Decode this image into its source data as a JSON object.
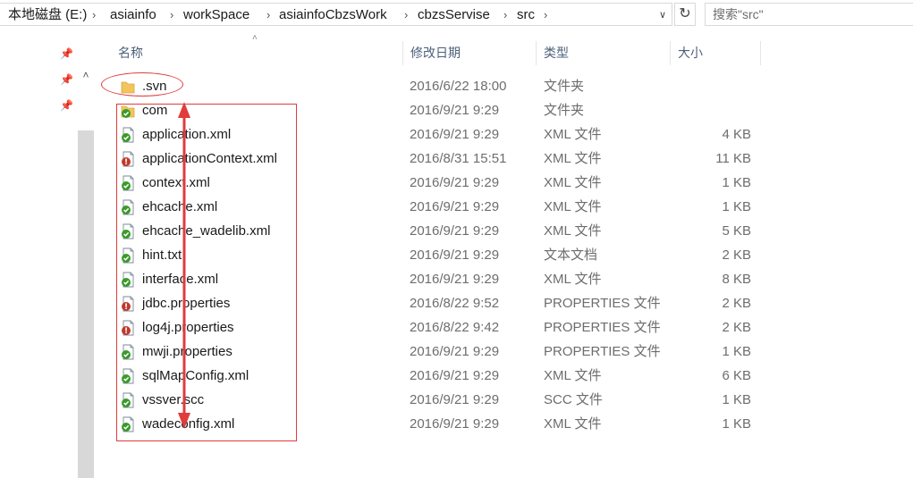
{
  "address_bar": {
    "crumbs": [
      "本地磁盘 (E:)",
      "asiainfo",
      "workSpace",
      "asiainfoCbzsWork",
      "cbzsServise",
      "src"
    ],
    "dropdown_icon": "chevron-down-icon",
    "refresh_icon": "refresh-icon"
  },
  "search": {
    "placeholder": "搜索\"src\""
  },
  "columns": {
    "name": "名称",
    "date": "修改日期",
    "type": "类型",
    "size": "大小"
  },
  "files": [
    {
      "name": ".svn",
      "date": "2016/6/22 18:00",
      "type": "文件夹",
      "size": "",
      "icon": "folder-icon"
    },
    {
      "name": "com",
      "date": "2016/9/21 9:29",
      "type": "文件夹",
      "size": "",
      "icon": "svn-folder-icon"
    },
    {
      "name": "application.xml",
      "date": "2016/9/21 9:29",
      "type": "XML 文件",
      "size": "4 KB",
      "icon": "svn-ok-file-icon"
    },
    {
      "name": "applicationContext.xml",
      "date": "2016/8/31 15:51",
      "type": "XML 文件",
      "size": "11 KB",
      "icon": "svn-modified-file-icon"
    },
    {
      "name": "context.xml",
      "date": "2016/9/21 9:29",
      "type": "XML 文件",
      "size": "1 KB",
      "icon": "svn-ok-file-icon"
    },
    {
      "name": "ehcache.xml",
      "date": "2016/9/21 9:29",
      "type": "XML 文件",
      "size": "1 KB",
      "icon": "svn-ok-file-icon"
    },
    {
      "name": "ehcache_wadelib.xml",
      "date": "2016/9/21 9:29",
      "type": "XML 文件",
      "size": "5 KB",
      "icon": "svn-ok-file-icon"
    },
    {
      "name": "hint.txt",
      "date": "2016/9/21 9:29",
      "type": "文本文档",
      "size": "2 KB",
      "icon": "svn-ok-file-icon"
    },
    {
      "name": "interface.xml",
      "date": "2016/9/21 9:29",
      "type": "XML 文件",
      "size": "8 KB",
      "icon": "svn-ok-file-icon"
    },
    {
      "name": "jdbc.properties",
      "date": "2016/8/22 9:52",
      "type": "PROPERTIES 文件",
      "size": "2 KB",
      "icon": "svn-modified-file-icon"
    },
    {
      "name": "log4j.properties",
      "date": "2016/8/22 9:42",
      "type": "PROPERTIES 文件",
      "size": "2 KB",
      "icon": "svn-modified-file-icon"
    },
    {
      "name": "mwji.properties",
      "date": "2016/9/21 9:29",
      "type": "PROPERTIES 文件",
      "size": "1 KB",
      "icon": "svn-ok-file-icon"
    },
    {
      "name": "sqlMapConfig.xml",
      "date": "2016/9/21 9:29",
      "type": "XML 文件",
      "size": "6 KB",
      "icon": "svn-ok-file-icon"
    },
    {
      "name": "vssver.scc",
      "date": "2016/9/21 9:29",
      "type": "SCC 文件",
      "size": "1 KB",
      "icon": "svn-ok-file-icon"
    },
    {
      "name": "wadeconfig.xml",
      "date": "2016/9/21 9:29",
      "type": "XML 文件",
      "size": "1 KB",
      "icon": "svn-ok-file-icon"
    }
  ],
  "colors": {
    "annotation": "#e03c3c",
    "header_text": "#4c607a",
    "svn_ok": "#3a9a2a",
    "svn_modified": "#c0392b",
    "folder": "#f2c55c"
  }
}
